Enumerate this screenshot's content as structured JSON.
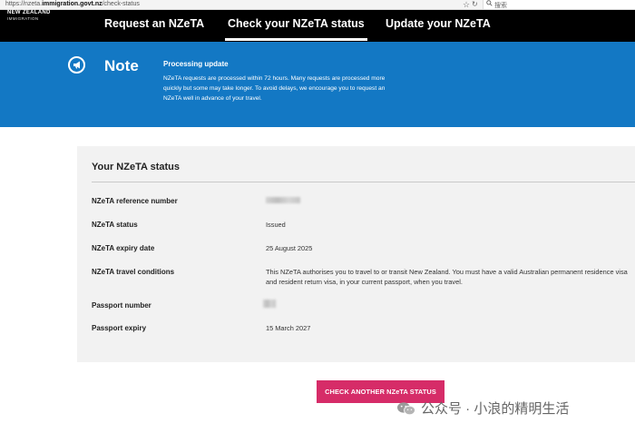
{
  "browser": {
    "url_prefix": "https://nzeta.",
    "url_domain": "immigration.govt.nz",
    "url_suffix": "/check-status",
    "search_placeholder": "搜索"
  },
  "logo": {
    "line1": "NEW ZEALAND",
    "line2": "IMMIGRATION"
  },
  "nav": {
    "tabs": [
      {
        "label": "Request an NZeTA",
        "active": false
      },
      {
        "label": "Check your NZeTA status",
        "active": true
      },
      {
        "label": "Update your NZeTA",
        "active": false
      }
    ]
  },
  "note": {
    "heading": "Note",
    "subheading": "Processing update",
    "body": "NZeTA requests are processed within 72 hours. Many requests are processed more quickly but some may take longer. To avoid delays, we encourage you to request an NZeTA well in advance of your travel.",
    "icon": "megaphone-icon",
    "background": "#1378c4"
  },
  "status": {
    "title": "Your NZeTA status",
    "rows": [
      {
        "label": "NZeTA reference number",
        "value": ""
      },
      {
        "label": "NZeTA status",
        "value": "Issued"
      },
      {
        "label": "NZeTA expiry date",
        "value": "25 August 2025"
      },
      {
        "label": "NZeTA travel conditions",
        "value": "This NZeTA authorises you to travel to or transit New Zealand. You must have a valid Australian permanent residence visa and resident return visa, in your current passport, when you travel."
      },
      {
        "label": "Passport number",
        "value": ""
      },
      {
        "label": "Passport expiry",
        "value": "15 March 2027"
      }
    ]
  },
  "actions": {
    "check_another": "CHECK ANOTHER NZeTA STATUS",
    "button_color": "#d62c68"
  },
  "watermark": {
    "text": "公众号 · 小浪的精明生活",
    "icon": "wechat-icon"
  }
}
